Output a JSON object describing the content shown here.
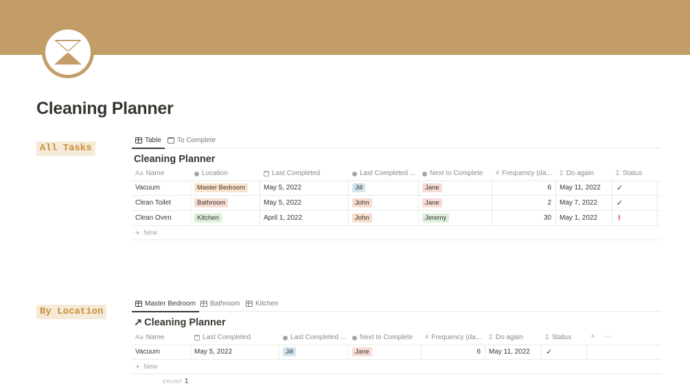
{
  "page": {
    "title": "Cleaning Planner",
    "colors": {
      "cover": "#c29d67",
      "callout_bg": "#f5ead7",
      "callout_text": "#c8903a",
      "alert": "#d22d2d"
    },
    "icon": "hourglass-icon"
  },
  "all_tasks": {
    "callout": "All Tasks",
    "tabs": [
      {
        "label": "Table",
        "icon": "table-icon",
        "active": true
      },
      {
        "label": "To Complete",
        "icon": "calendar-icon",
        "active": false
      }
    ],
    "db_title": "Cleaning Planner",
    "headers": [
      "Name",
      "Location",
      "Last Completed",
      "Last Completed ...",
      "Next to Complete",
      "Frequency (da...",
      "Do again",
      "Status"
    ],
    "header_icons": [
      "Aa",
      "select",
      "date",
      "select",
      "select",
      "#",
      "Σ",
      "Σ"
    ],
    "rows": [
      {
        "name": "Vacuum",
        "location": "Master Bedroom",
        "last_completed": "May 5, 2022",
        "last_by": "Jill",
        "next": "Jane",
        "frequency": "6",
        "do_again": "May 11, 2022",
        "status": "✓"
      },
      {
        "name": "Clean Toilet",
        "location": "Bathroom",
        "last_completed": "May 5, 2022",
        "last_by": "John",
        "next": "Jane",
        "frequency": "2",
        "do_again": "May 7, 2022",
        "status": "✓"
      },
      {
        "name": "Clean Oven",
        "location": "Kitchen",
        "last_completed": "April 1, 2022",
        "last_by": "John",
        "next": "Jeremy",
        "frequency": "30",
        "do_again": "May 1, 2022",
        "status": "!"
      }
    ],
    "new_label": "New"
  },
  "by_location": {
    "callout": "By Location",
    "tabs": [
      {
        "label": "Master Bedroom",
        "icon": "table-icon",
        "active": true
      },
      {
        "label": "Bathroom",
        "icon": "table-icon",
        "active": false
      },
      {
        "label": "Kitchen",
        "icon": "table-icon",
        "active": false
      }
    ],
    "db_title": "Cleaning Planner",
    "db_title_icon": "↗",
    "headers": [
      "Name",
      "Last Completed",
      "Last Completed ...",
      "Next to Complete",
      "Frequency (da...",
      "Do again",
      "Status"
    ],
    "rows": [
      {
        "name": "Vacuum",
        "last_completed": "May 5, 2022",
        "last_by": "Jill",
        "next": "Jane",
        "frequency": "6",
        "do_again": "May 11, 2022",
        "status": "✓"
      }
    ],
    "new_label": "New",
    "count_label": "COUNT",
    "count_value": "1",
    "add_icon": "+",
    "more_icon": "···"
  }
}
